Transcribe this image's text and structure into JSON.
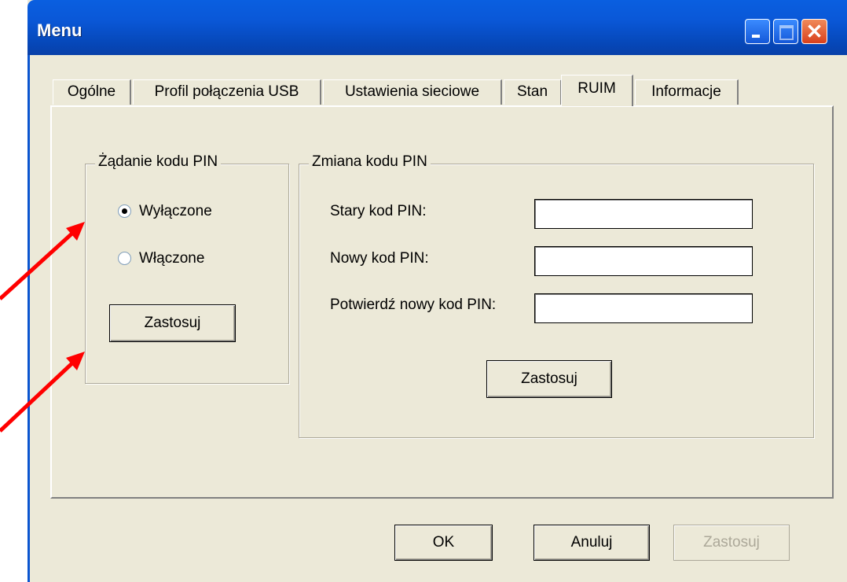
{
  "window": {
    "title": "Menu",
    "close_glyph": "✕"
  },
  "tabs": [
    {
      "label": "Ogólne",
      "active": false
    },
    {
      "label": "Profil połączenia USB",
      "active": false
    },
    {
      "label": "Ustawienia sieciowe",
      "active": false
    },
    {
      "label": "Stan",
      "active": false
    },
    {
      "label": "RUIM",
      "active": true
    },
    {
      "label": "Informacje",
      "active": false
    }
  ],
  "pin_request": {
    "legend": "Żądanie kodu PIN",
    "options": [
      {
        "label": "Wyłączone",
        "selected": true
      },
      {
        "label": "Włączone",
        "selected": false
      }
    ],
    "apply_label": "Zastosuj"
  },
  "pin_change": {
    "legend": "Zmiana kodu PIN",
    "fields": [
      {
        "label": "Stary kod PIN:",
        "value": ""
      },
      {
        "label": "Nowy kod PIN:",
        "value": ""
      },
      {
        "label": "Potwierdź nowy kod PIN:",
        "value": ""
      }
    ],
    "apply_label": "Zastosuj"
  },
  "footer": {
    "ok_label": "OK",
    "cancel_label": "Anuluj",
    "apply_label": "Zastosuj",
    "apply_disabled": true
  },
  "annotations": {
    "arrow_color": "#ff0000",
    "arrow_count": 2
  },
  "colors": {
    "titlebar": "#0a58d8",
    "face": "#ece9d8"
  }
}
